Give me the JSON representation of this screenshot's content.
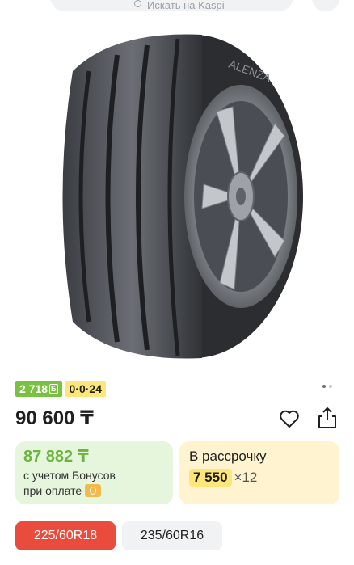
{
  "search": {
    "placeholder": "Искать на Kaspi"
  },
  "price": {
    "value": "90 600 ₸"
  },
  "badges": {
    "bonus": "2 718",
    "bonus_unit": "Б",
    "installment": "0·0·24"
  },
  "gallery": {
    "total_dots": 2,
    "active_index": 0
  },
  "bonus_card": {
    "price": "87 882 ₸",
    "line1": "с учетом Бонусов",
    "line2": "при оплате"
  },
  "installment_card": {
    "title": "В рассрочку",
    "amount": "7 550",
    "months": "×12"
  },
  "sizes": [
    {
      "label": "225/60R18",
      "selected": true
    },
    {
      "label": "235/60R16",
      "selected": false
    }
  ],
  "colors": {
    "accent_red": "#e94b3c",
    "bonus_green": "#7ac142",
    "installment_yellow": "#fde67a"
  },
  "image": {
    "subject": "Bridgestone Alenza tire with alloy wheel",
    "sidewall_text": "ALENZA"
  }
}
